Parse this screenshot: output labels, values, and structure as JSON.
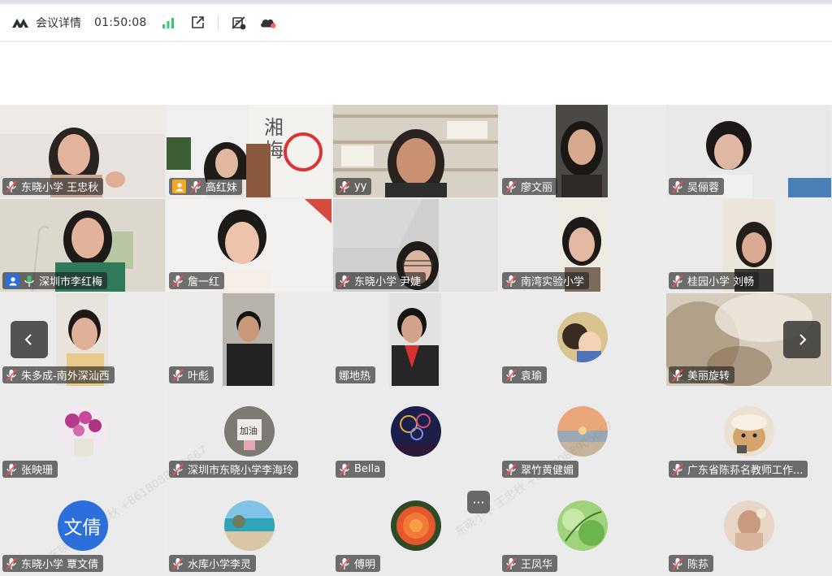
{
  "header": {
    "title": "会议详情",
    "timer": "01:50:08"
  },
  "watermark": "东晓小学 王忠秋 +8618088905667",
  "more_label": "···",
  "colors": {
    "active_border": "#3ec46d",
    "signal": "#2ecc71",
    "cloud_dot": "#ff6b4a"
  },
  "participants": [
    {
      "name": "东晓小学 王忠秋"
    },
    {
      "name": "高红妹"
    },
    {
      "name": "yy"
    },
    {
      "name": "廖文丽"
    },
    {
      "name": "吴俪蓉"
    },
    {
      "name": "深圳市李红梅"
    },
    {
      "name": "詹一红"
    },
    {
      "name": "东晓小学 尹婕"
    },
    {
      "name": "南湾实验小学"
    },
    {
      "name": "桂园小学 刘畅"
    },
    {
      "name": "朱多成-南外深汕西"
    },
    {
      "name": "叶彪"
    },
    {
      "name": "娜地热"
    },
    {
      "name": "袁瑜"
    },
    {
      "name": "美丽旋转"
    },
    {
      "name": "张映珊"
    },
    {
      "name": "深圳市东晓小学李海玲"
    },
    {
      "name": "Bella"
    },
    {
      "name": "翠竹黄健媚"
    },
    {
      "name": "广东省陈荪名教师工作..."
    },
    {
      "name": "东晓小学 覃文倩",
      "avatar_text": "文倩"
    },
    {
      "name": "水库小学李灵"
    },
    {
      "name": "傅明"
    },
    {
      "name": "王凤华"
    },
    {
      "name": "陈荪"
    }
  ]
}
